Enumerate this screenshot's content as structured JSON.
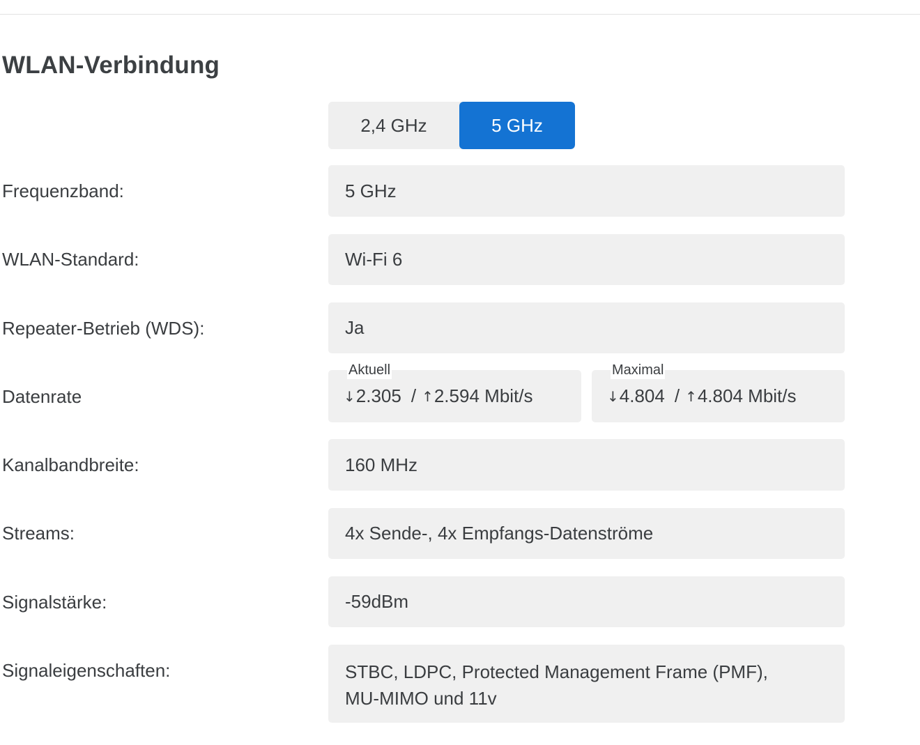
{
  "section_title": "WLAN-Verbindung",
  "band_switch": {
    "options": [
      "2,4 GHz",
      "5 GHz"
    ],
    "selected": "5 GHz"
  },
  "rows": {
    "frequenzband": {
      "label": "Frequenzband:",
      "value": "5 GHz"
    },
    "standard": {
      "label": "WLAN-Standard:",
      "value": "Wi-Fi 6"
    },
    "repeater": {
      "label": "Repeater-Betrieb (WDS):",
      "value": "Ja"
    },
    "datenrate": {
      "label": "Datenrate",
      "aktuell": {
        "caption": "Aktuell",
        "down": "2.305",
        "up": "2.594",
        "unit": "Mbit/s"
      },
      "maximal": {
        "caption": "Maximal",
        "down": "4.804",
        "up": "4.804",
        "unit": "Mbit/s"
      }
    },
    "kanalbandbreite": {
      "label": "Kanalbandbreite:",
      "value": "160 MHz"
    },
    "streams": {
      "label": "Streams:",
      "value": "4x Sende-, 4x Empfangs-Datenströme"
    },
    "signalstaerke": {
      "label": "Signalstärke:",
      "value": "-59dBm"
    },
    "signaleigenschaften": {
      "label": "Signaleigenschaften:",
      "value_line1": "STBC, LDPC, Protected Management Frame (PMF),",
      "value_line2": "MU-MIMO und 11v"
    }
  },
  "icons": {
    "down": "arrow-down-icon",
    "up": "arrow-up-icon"
  },
  "colors": {
    "accent": "#1473d3",
    "field_bg": "#f0f0f0",
    "text": "#3a3d40"
  }
}
